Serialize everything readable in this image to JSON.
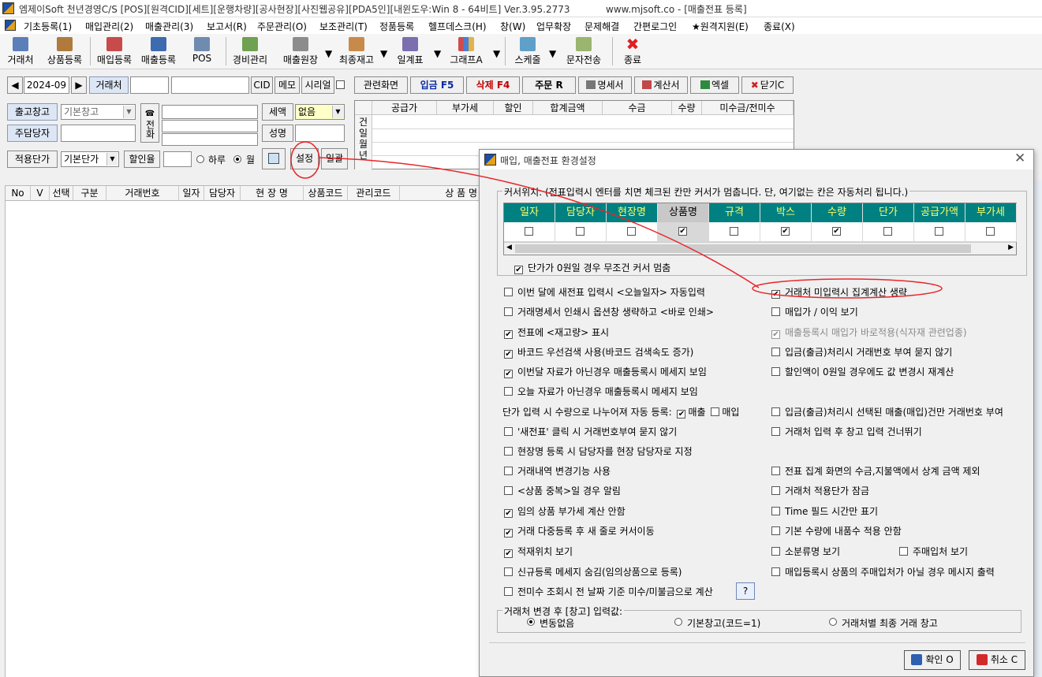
{
  "window": {
    "title": "엠제이Soft 천년경영C/S [POS][원격CID][세트][운행차량][공사현장][사진웹공유][PDA5인][내윈도우:Win 8 - 64비트] Ver.3.95.2773",
    "url": "www.mjsoft.co - [매출전표 등록]"
  },
  "menu": [
    "기초등록(1)",
    "매입관리(2)",
    "매출관리(3)",
    "보고서(R)",
    "주문관리(O)",
    "보조관리(T)",
    "정품등록",
    "헬프데스크(H)",
    "창(W)",
    "업무확장",
    "문제해결",
    "간편로그인",
    "★원격지원(E)",
    "종료(X)"
  ],
  "toolbar": {
    "customer": "거래처",
    "product_register": "상품등록",
    "purchase_register": "매입등록",
    "sales_register": "매출등록",
    "pos": "POS",
    "expense": "경비관리",
    "sales_ledger": "매출원장",
    "latest_stock": "최종재고",
    "daily_table": "일계표",
    "graph": "그래프A",
    "schedule": "스케줄",
    "sms": "문자전송",
    "exit": "종료"
  },
  "form": {
    "month": "2024-09",
    "customer_label": "거래처",
    "cid": "CID",
    "memo": "메모",
    "serial": "시리얼",
    "warehouse_label": "출고창고",
    "warehouse_value": "기본창고",
    "phone_label": "전화",
    "tax_label": "세액",
    "tax_value": "없음",
    "manager_label": "주담당자",
    "name_label": "성명",
    "price_label": "적용단가",
    "price_value": "기본단가",
    "discount_label": "할인율",
    "day": "하루",
    "month_radio": "월",
    "settings": "설정",
    "batch": "일괄"
  },
  "actions": {
    "related": "관련화면",
    "deposit": "입금 F5",
    "delete": "삭제 F4",
    "order": "주문 R",
    "statement": "명세서",
    "invoice": "계산서",
    "excel": "엑셀",
    "close": "닫기C"
  },
  "summary": {
    "headers": [
      "공급가",
      "부가세",
      "할인",
      "합계금액",
      "수금",
      "수량",
      "미수금/전미수"
    ],
    "side": [
      "건",
      "일",
      "월",
      "년"
    ]
  },
  "grid": {
    "headers": [
      "No",
      "V",
      "선택",
      "구분",
      "거래번호",
      "일자",
      "담당자",
      "현 장 명",
      "상품코드",
      "관리코드",
      "상 품 명"
    ]
  },
  "dialog": {
    "title": "매입, 매출전표 환경설정",
    "cursor_group": "커서위치: (전표입력시 엔터를 치면 체크된 칸만 커서가 멈춥니다. 단, 여기없는 칸은 자동처리 됩니다.)",
    "cursor_columns": [
      {
        "label": "일자",
        "checked": false
      },
      {
        "label": "담당자",
        "checked": false
      },
      {
        "label": "현장명",
        "checked": false
      },
      {
        "label": "상품명",
        "checked": true
      },
      {
        "label": "규격",
        "checked": false
      },
      {
        "label": "박스",
        "checked": true
      },
      {
        "label": "수량",
        "checked": true
      },
      {
        "label": "단가",
        "checked": false
      },
      {
        "label": "공급가액",
        "checked": false
      },
      {
        "label": "부가세",
        "checked": false
      }
    ],
    "zero_price_stop": "단가가 0원일 경우 무조건 커서 멈춤",
    "left_options": [
      {
        "label": "이번 달에 새전표 입력시 <오늘일자> 자동입력",
        "checked": false
      },
      {
        "label": "거래명세서 인쇄시 옵션창 생략하고 <바로 인쇄>",
        "checked": false
      },
      {
        "label": "전표에 <재고량> 표시",
        "checked": true
      },
      {
        "label": "바코드 우선검색 사용(바코드 검색속도 증가)",
        "checked": true
      },
      {
        "label": "이번달 자료가 아닌경우 매출등록시 메세지 보임",
        "checked": true
      },
      {
        "label": "오늘 자료가 아닌경우 매출등록시 메세지 보임",
        "checked": false
      }
    ],
    "qty_divide_label": "단가 입력 시 수량으로 나누어져 자동 등록:",
    "qty_divide_sales": "매출",
    "qty_divide_purchase": "매입",
    "left_options2": [
      {
        "label": "'새전표' 클릭 시 거래번호부여 묻지 않기",
        "checked": false
      },
      {
        "label": "현장명 등록 시 담당자를 현장 담당자로 지정",
        "checked": false
      },
      {
        "label": "거래내역 변경기능 사용",
        "checked": false
      },
      {
        "label": "<상품 중복>일 경우 알림",
        "checked": false
      },
      {
        "label": "임의 상품 부가세 계산 안함",
        "checked": true
      },
      {
        "label": "거래 다중등록 후 새 줄로 커서이동",
        "checked": true
      },
      {
        "label": "적재위치 보기",
        "checked": true
      },
      {
        "label": "신규등록 메세지 숨김(임의상품으로 등록)",
        "checked": false
      },
      {
        "label": "전미수 조회시 전 날짜 기준 미수/미불금으로 계산",
        "checked": false
      }
    ],
    "help": "?",
    "right_options": [
      {
        "label": "거래처 미입력시 집계계산 생략",
        "checked": true
      },
      {
        "label": "매입가 / 이익 보기",
        "checked": false
      },
      {
        "label": "매출등록시 매입가 바로적용(식자재 관련업종)",
        "checked": true
      },
      {
        "label": "입금(출금)처리시 거래번호 부여 묻지 않기",
        "checked": false
      },
      {
        "label": "할인액이 0원일 경우에도 값 변경시 재계산",
        "checked": false
      }
    ],
    "right_options2": [
      {
        "label": "입금(출금)처리시 선택된 매출(매입)건만 거래번호 부여",
        "checked": false
      },
      {
        "label": "거래처 입력 후 창고 입력 건너뛰기",
        "checked": false
      },
      {
        "label": "전표 집계 화면의 수금,지불액에서 상계 금액 제외",
        "checked": false
      },
      {
        "label": "거래처 적용단가 잠금",
        "checked": false
      },
      {
        "label": "Time 필드 시간만 표기",
        "checked": false
      },
      {
        "label": "기본 수량에 내품수 적용 안함",
        "checked": false
      },
      {
        "label": "소분류명 보기",
        "checked": false
      },
      {
        "label": "매입등록시 상품의 주매입처가 아닐 경우 메시지 출력",
        "checked": false
      }
    ],
    "main_supplier": "주매입처 보기",
    "warehouse_group": "거래처 변경 후 [창고] 입력값:",
    "warehouse_radios": [
      "변동없음",
      "기본창고(코드=1)",
      "거래처별 최종 거래 창고"
    ],
    "ok": "확인 O",
    "cancel": "취소 C"
  },
  "colors": {
    "accent_teal": "#008080",
    "accent_text": "#ffff66",
    "annotation": "#e8262b"
  }
}
